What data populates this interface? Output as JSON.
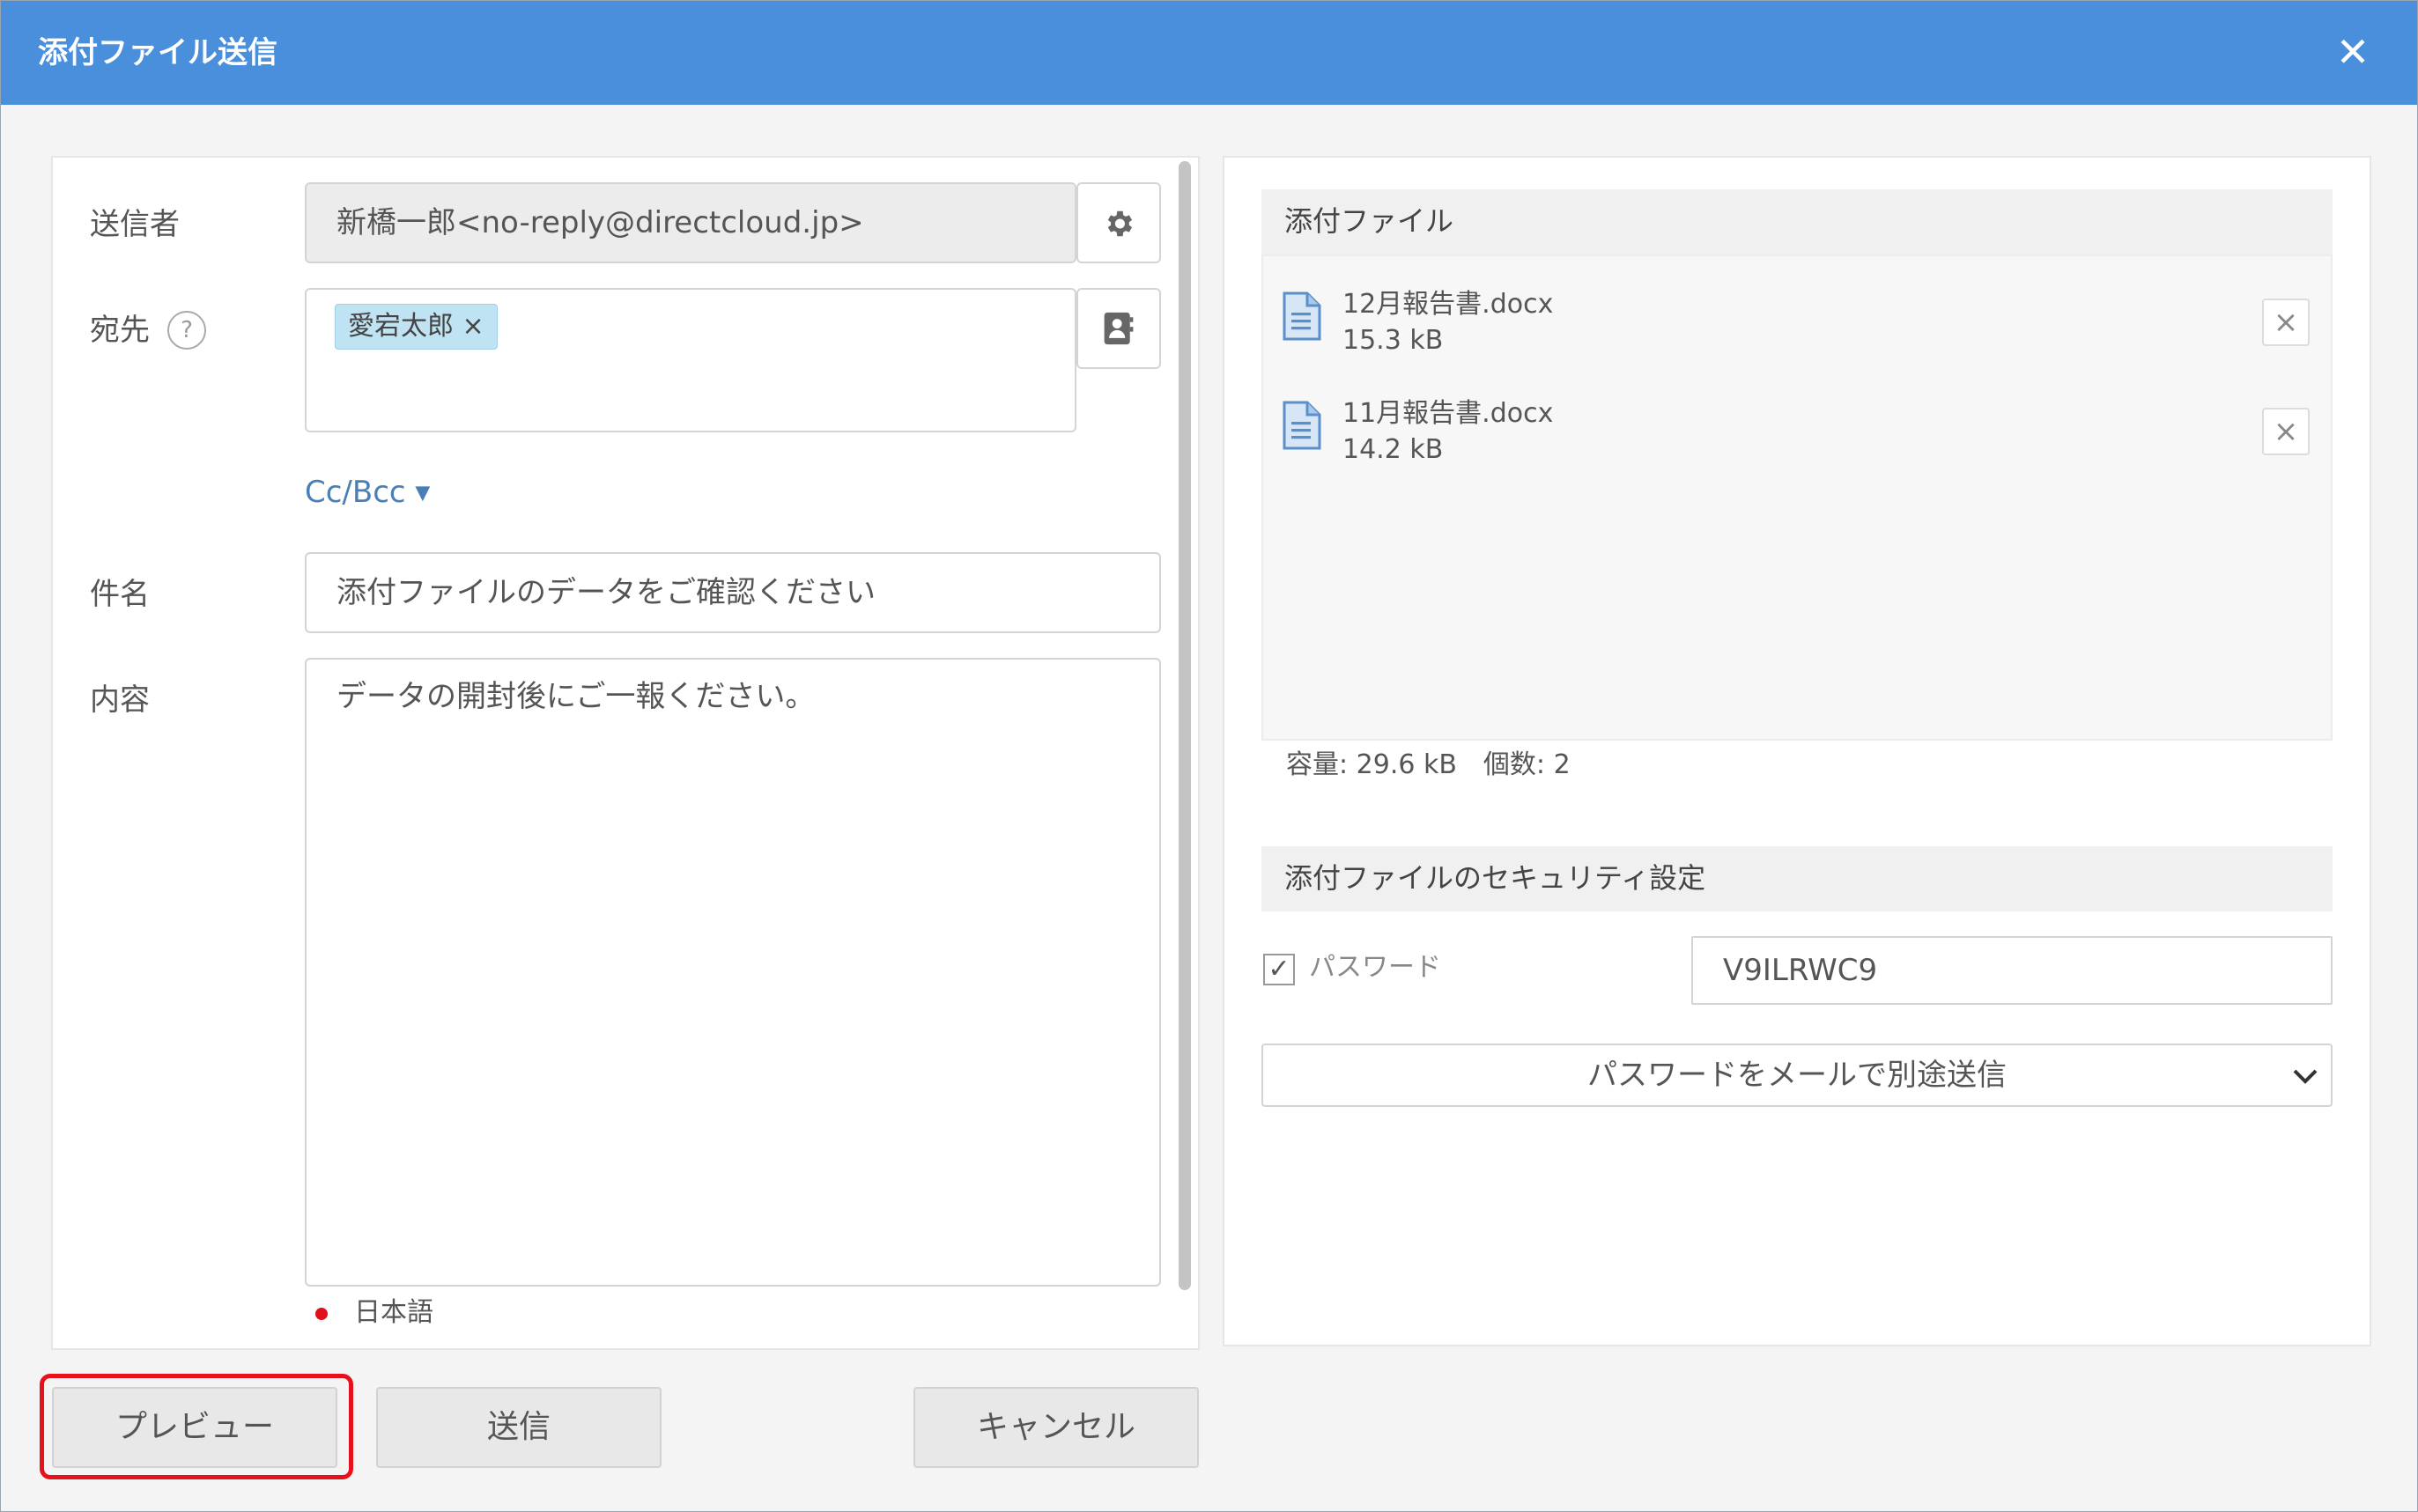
{
  "window": {
    "title": "添付ファイル送信",
    "close_icon": "close-icon"
  },
  "form": {
    "sender_label": "送信者",
    "sender_value": "新橋一郎<no-reply@directcloud.jp>",
    "recipient_label": "宛先",
    "help_glyph": "?",
    "recipients": [
      {
        "name": "愛宕太郎",
        "remove": "×"
      }
    ],
    "cc_bcc": "Cc/Bcc",
    "subject_label": "件名",
    "subject_value": "添付ファイルのデータをご確認ください",
    "body_label": "内容",
    "body_value": "データの開封後にご一報ください。",
    "language": "日本語"
  },
  "attachments": {
    "header": "添付ファイル",
    "files": [
      {
        "name": "12月報告書.docx",
        "size": "15.3 kB"
      },
      {
        "name": "11月報告書.docx",
        "size": "14.2 kB"
      }
    ],
    "summary": "容量: 29.6 kB　個数: 2"
  },
  "security": {
    "header": "添付ファイルのセキュリティ設定",
    "password_label": "パスワード",
    "password_checked": true,
    "password_value": "V9ILRWC9",
    "delivery_option": "パスワードをメールで別途送信"
  },
  "buttons": {
    "preview": "プレビュー",
    "send": "送信",
    "cancel": "キャンセル"
  },
  "colors": {
    "titlebar": "#4a8fdb",
    "highlight": "#e8101a",
    "tag": "#bfe3f2",
    "link": "#4a7fb6"
  }
}
